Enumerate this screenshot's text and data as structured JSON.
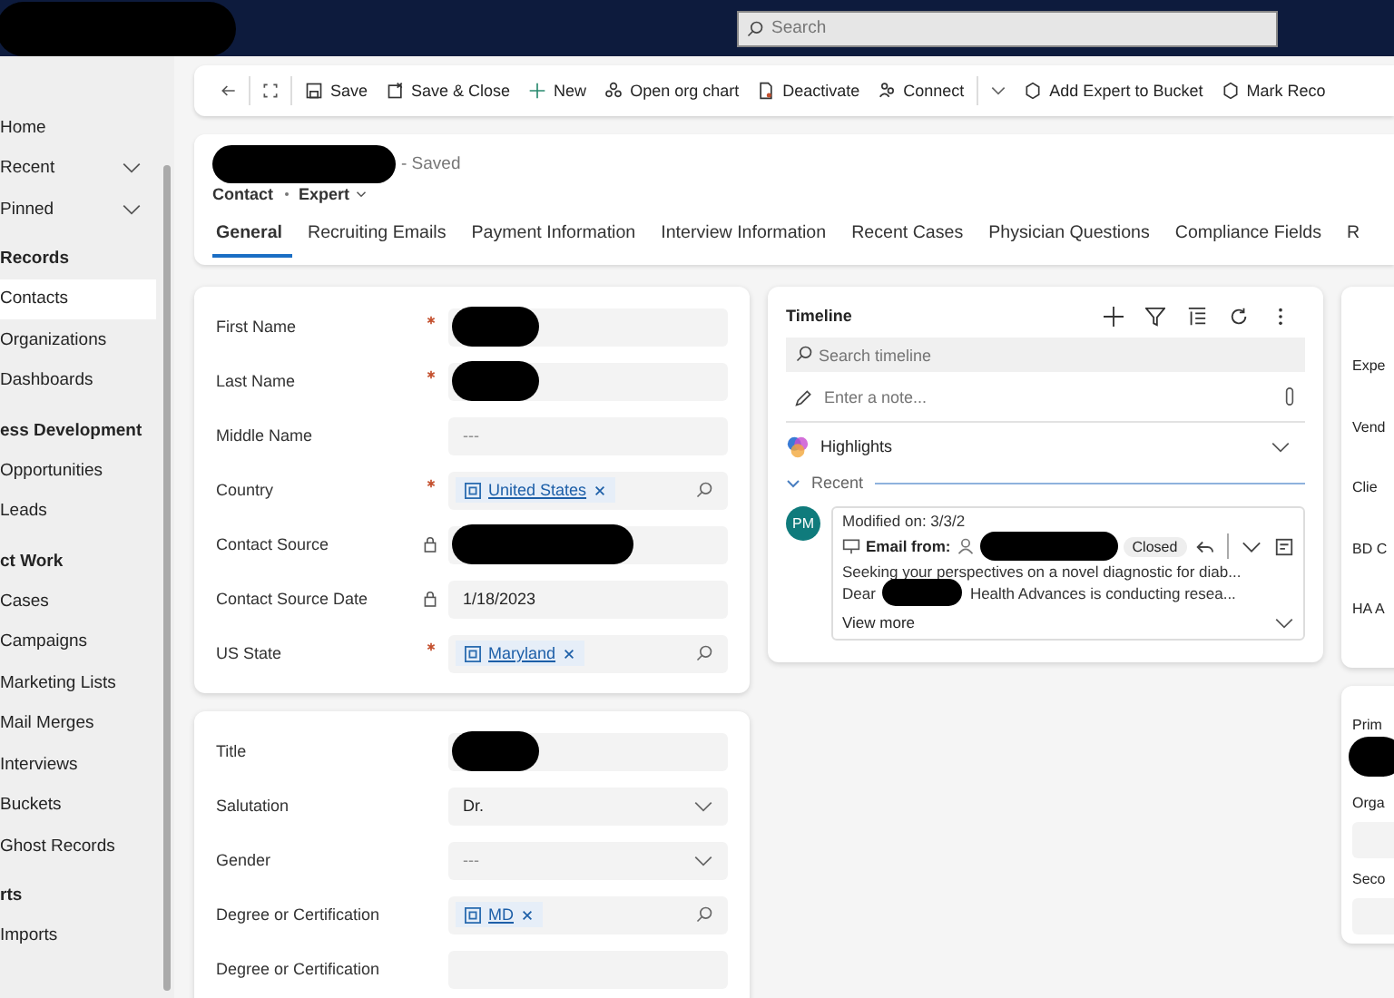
{
  "top_bar": {
    "search": {
      "placeholder": "Search"
    }
  },
  "sidebar": {
    "items": [
      {
        "kind": "item",
        "label": "Home",
        "selected": false
      },
      {
        "kind": "menu",
        "label": "Recent",
        "selected": false
      },
      {
        "kind": "menu",
        "label": "Pinned",
        "selected": false
      },
      {
        "kind": "heading",
        "label": "Records"
      },
      {
        "kind": "item",
        "label": "Contacts",
        "selected": true
      },
      {
        "kind": "item",
        "label": "Organizations",
        "selected": false
      },
      {
        "kind": "item",
        "label": "Dashboards",
        "selected": false
      },
      {
        "kind": "heading",
        "label": "ess Development"
      },
      {
        "kind": "item",
        "label": "Opportunities",
        "selected": false
      },
      {
        "kind": "item",
        "label": "Leads",
        "selected": false
      },
      {
        "kind": "heading",
        "label": "ct Work"
      },
      {
        "kind": "item",
        "label": "Cases",
        "selected": false
      },
      {
        "kind": "item",
        "label": "Campaigns",
        "selected": false
      },
      {
        "kind": "item",
        "label": "Marketing Lists",
        "selected": false
      },
      {
        "kind": "item",
        "label": "Mail Merges",
        "selected": false
      },
      {
        "kind": "item",
        "label": "Interviews",
        "selected": false
      },
      {
        "kind": "item",
        "label": "Buckets",
        "selected": false
      },
      {
        "kind": "item",
        "label": "Ghost Records",
        "selected": false
      },
      {
        "kind": "heading",
        "label": "rts"
      },
      {
        "kind": "item",
        "label": "Imports",
        "selected": false
      }
    ]
  },
  "command_bar": [
    {
      "kind": "back"
    },
    {
      "kind": "popout"
    },
    {
      "kind": "save",
      "label": "Save"
    },
    {
      "kind": "save_close",
      "label": "Save & Close"
    },
    {
      "kind": "new",
      "label": "New"
    },
    {
      "kind": "org",
      "label": "Open org chart"
    },
    {
      "kind": "deactivate",
      "label": "Deactivate"
    },
    {
      "kind": "connect",
      "label": "Connect"
    },
    {
      "kind": "more"
    },
    {
      "kind": "bucket",
      "label": "Add Expert to Bucket"
    },
    {
      "kind": "bucket",
      "label": "Mark Reco"
    }
  ],
  "record": {
    "status": "- Saved",
    "entity": "Contact",
    "form": "Expert"
  },
  "tabs": [
    {
      "label": "General",
      "selected": true
    },
    {
      "label": "Recruiting Emails",
      "selected": false
    },
    {
      "label": "Payment Information",
      "selected": false
    },
    {
      "label": "Interview Information",
      "selected": false
    },
    {
      "label": "Recent Cases",
      "selected": false
    },
    {
      "label": "Physician Questions",
      "selected": false
    },
    {
      "label": "Compliance Fields",
      "selected": false
    },
    {
      "label": "R",
      "selected": false
    }
  ],
  "form_sections": [
    {
      "fields": [
        {
          "label": "First Name",
          "kind": "redacted",
          "required": true,
          "locked": false
        },
        {
          "label": "Last Name",
          "kind": "redacted",
          "required": true,
          "locked": false
        },
        {
          "label": "Middle Name",
          "kind": "text",
          "placeholder": "---",
          "required": false,
          "locked": false
        },
        {
          "label": "Country",
          "kind": "lookup",
          "value": "United States",
          "required": true,
          "locked": false
        },
        {
          "label": "Contact Source",
          "kind": "redacted",
          "required": false,
          "locked": true
        },
        {
          "label": "Contact Source Date",
          "kind": "text",
          "value": "1/18/2023",
          "required": false,
          "locked": true
        },
        {
          "label": "US State",
          "kind": "lookup",
          "value": "Maryland",
          "required": true,
          "locked": false
        }
      ]
    },
    {
      "fields": [
        {
          "label": "Title",
          "kind": "redacted",
          "required": false,
          "locked": false
        },
        {
          "label": "Salutation",
          "kind": "select",
          "value": "Dr.",
          "required": false,
          "locked": false
        },
        {
          "label": "Gender",
          "kind": "select",
          "placeholder": "---",
          "required": false,
          "locked": false
        },
        {
          "label": "Degree or Certification",
          "kind": "lookup",
          "value": "MD",
          "required": false,
          "locked": false
        },
        {
          "label": "Degree or Certification",
          "kind": "text",
          "required": false,
          "locked": false
        }
      ]
    }
  ],
  "timeline": {
    "title": "Timeline",
    "search": {
      "placeholder": "Search timeline"
    },
    "note": {
      "placeholder": "Enter a note..."
    },
    "highlights": "Highlights",
    "group": "Recent",
    "entries": [
      {
        "initials": "PM",
        "modified": "Modified on: 3/3/2",
        "type": "Email from:",
        "status": "Closed",
        "subject": "Seeking your perspectives on a novel diagnostic for diab...",
        "greeting": "Dear",
        "body": "Health Advances is conducting resea...",
        "more": "View more"
      }
    ]
  },
  "right_cards": [
    {
      "labels": [
        "Expe",
        "Vend",
        "Clie",
        "BD C",
        "HA A"
      ]
    },
    {
      "labels": [
        "Prim",
        "Orga",
        "Seco"
      ]
    }
  ]
}
